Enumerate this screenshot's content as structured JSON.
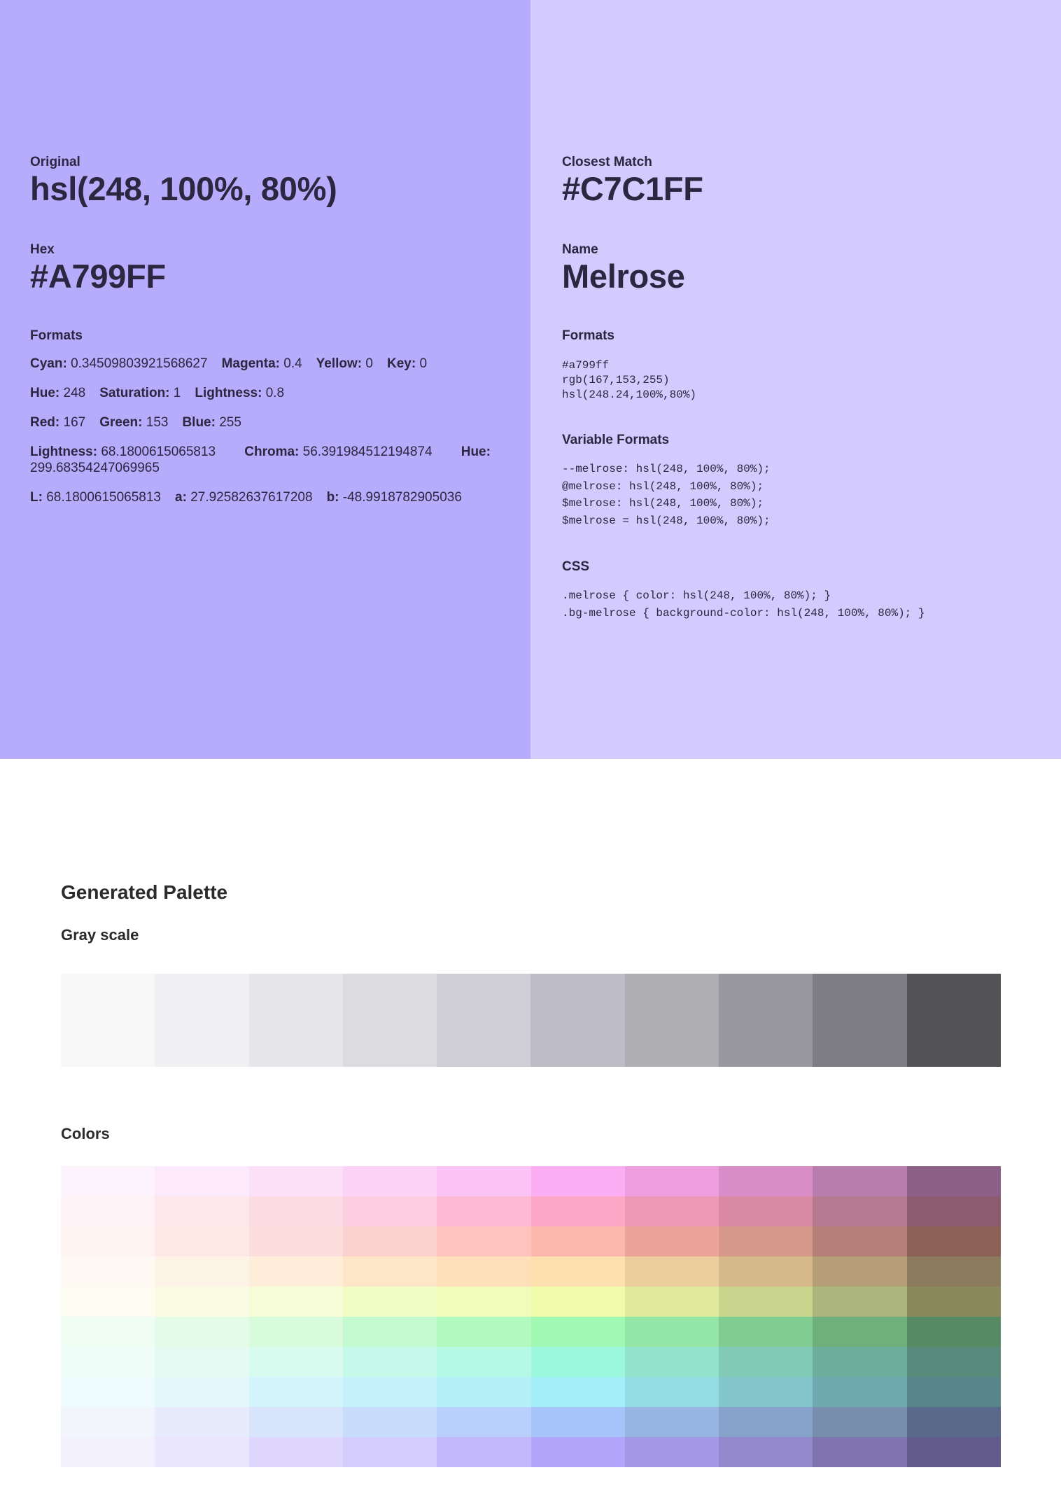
{
  "original": {
    "label": "Original",
    "value": "hsl(248, 100%, 80%)",
    "hex_label": "Hex",
    "hex": "#A799FF",
    "formats_label": "Formats",
    "cmyk": [
      {
        "key": "Cyan:",
        "val": "0.34509803921568627"
      },
      {
        "key": "Magenta:",
        "val": "0.4"
      },
      {
        "key": "Yellow:",
        "val": "0"
      },
      {
        "key": "Key:",
        "val": "0"
      }
    ],
    "hsl": [
      {
        "key": "Hue:",
        "val": "248"
      },
      {
        "key": "Saturation:",
        "val": "1"
      },
      {
        "key": "Lightness:",
        "val": "0.8"
      }
    ],
    "rgb": [
      {
        "key": "Red:",
        "val": "167"
      },
      {
        "key": "Green:",
        "val": "153"
      },
      {
        "key": "Blue:",
        "val": "255"
      }
    ],
    "lch": [
      {
        "key": "Lightness:",
        "val": "68.1800615065813"
      },
      {
        "key": "Chroma:",
        "val": "56.391984512194874"
      },
      {
        "key": "Hue:",
        "val": "299.68354247069965"
      }
    ],
    "lab": [
      {
        "key": "L:",
        "val": "68.1800615065813"
      },
      {
        "key": "a:",
        "val": "27.92582637617208"
      },
      {
        "key": "b:",
        "val": "-48.9918782905036"
      }
    ]
  },
  "match": {
    "label": "Closest Match",
    "hex": "#C7C1FF",
    "name_label": "Name",
    "name": "Melrose",
    "formats_label": "Formats",
    "formats": [
      "#a799ff",
      "rgb(167,153,255)",
      "hsl(248.24,100%,80%)"
    ],
    "var_label": "Variable Formats",
    "variables": [
      "--melrose: hsl(248, 100%, 80%);",
      "@melrose: hsl(248, 100%, 80%);",
      "$melrose: hsl(248, 100%, 80%);",
      "$melrose = hsl(248, 100%, 80%);"
    ],
    "css_label": "CSS",
    "css": [
      ".melrose { color: hsl(248, 100%, 80%); }",
      ".bg-melrose { background-color: hsl(248, 100%, 80%); }"
    ]
  },
  "palette": {
    "title": "Generated Palette",
    "gray_title": "Gray scale",
    "gray": [
      "#f8f8f9",
      "#f0f0f2",
      "#e7e6ea",
      "#dcdce0",
      "#cfcdd6",
      "#bebcc6",
      "#afaeb3",
      "#99989e",
      "#7e7d84",
      "#535257"
    ],
    "colors_title": "Colors",
    "colors": [
      [
        "#fdf3fc",
        "#fce9fb",
        "#fce0f8",
        "#fcd3f7",
        "#fcc4f6",
        "#fbaef4",
        "#ee9ede",
        "#d98ec8",
        "#b87cad",
        "#8c5f86"
      ],
      [
        "#fdf3f6",
        "#fde7ec",
        "#fcdbe4",
        "#fccee0",
        "#fcbbd3",
        "#fca8c6",
        "#ed99b6",
        "#d88aa4",
        "#b67a90",
        "#8b5c6e"
      ],
      [
        "#fdf4f2",
        "#fde8e6",
        "#fcdedd",
        "#fcd2d0",
        "#fcc4bd",
        "#fcb8ac",
        "#eca498",
        "#d69888",
        "#b67e78",
        "#8b6158"
      ],
      [
        "#fefaf3",
        "#fdf3e6",
        "#fdedd9",
        "#fde6c7",
        "#fde0ba",
        "#fde0ad",
        "#eccd9e",
        "#d6b98b",
        "#b59e78",
        "#8b7a5b"
      ],
      [
        "#fcfdf0",
        "#f9fce3",
        "#f6fcd6",
        "#f2fcc5",
        "#f2fcba",
        "#effba8",
        "#dfea9c",
        "#c9d48c",
        "#acb57b",
        "#888a5e"
      ],
      [
        "#f0fdf2",
        "#e4fbe8",
        "#d8fbdc",
        "#c5fad0",
        "#b2f9bf",
        "#a0f8b3",
        "#93e6a6",
        "#81cc90",
        "#6eaf7c",
        "#578a62"
      ],
      [
        "#effdf9",
        "#e4fbf3",
        "#d7fbef",
        "#c5faea",
        "#b4f9e4",
        "#9cf8dd",
        "#92e3cc",
        "#80cab6",
        "#6eae9d",
        "#578a7b"
      ],
      [
        "#effcfd",
        "#e2f8fb",
        "#d4f5fb",
        "#c5f2fa",
        "#b5f0f9",
        "#a4f0f9",
        "#93dce3",
        "#83c6cc",
        "#6eaab0",
        "#57858b"
      ],
      [
        "#f3f5fd",
        "#e6ecfc",
        "#d8e3fc",
        "#c8dcfc",
        "#b8d0fb",
        "#a6c4fa",
        "#97b5e3",
        "#88a3cb",
        "#788ead",
        "#59698b"
      ],
      [
        "#f3f1fd",
        "#eae6fd",
        "#dfd6fd",
        "#d4ccfd",
        "#c4b8fc",
        "#b3a5fb",
        "#a497e5",
        "#9488cd",
        "#8074b0",
        "#625a8b"
      ]
    ]
  }
}
